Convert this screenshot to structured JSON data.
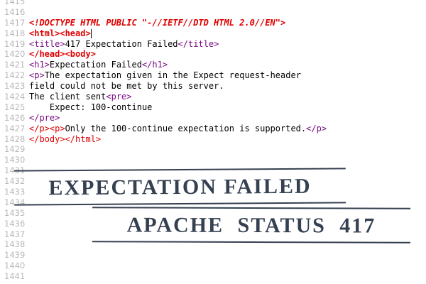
{
  "line_numbers": [
    "1415",
    "1416",
    "1417",
    "1418",
    "1419",
    "1420",
    "1421",
    "1422",
    "1423",
    "1424",
    "1425",
    "1426",
    "1427",
    "1428",
    "1429",
    "1430",
    "1431",
    "1432",
    "1433",
    "1434",
    "1435",
    "1436",
    "1437",
    "1438",
    "1439",
    "1440",
    "1441"
  ],
  "code": {
    "doctype": "<!DOCTYPE HTML PUBLIC \"-//IETF//DTD HTML 2.0//EN\">",
    "html_head": "<html><head>",
    "title_open": "<title>",
    "title_text": "417 Expectation Failed",
    "title_close": "</title>",
    "head_body": "</head><body>",
    "h1_open": "<h1>",
    "h1_text": "Expectation Failed",
    "h1_close": "</h1>",
    "p_open": "<p>",
    "p_text1": "The expectation given in the Expect request-header",
    "p_text2": "field could not be met by this server.",
    "p_text3": "The client sent",
    "pre_open": "<pre>",
    "pre_text": "    Expect: 100-continue",
    "pre_close": "</pre>",
    "p_close_open": "</p><p>",
    "p2_text": "Only the 100-continue expectation is supported.",
    "p2_close": "</p>",
    "body_close": "</body></html>"
  },
  "stamps": {
    "line1": "EXPECTATION  FAILED",
    "line2": "APACHE STATUS 417"
  },
  "colors": {
    "keyword": "#e00000",
    "tag": "#7a0b86",
    "stamp": "#2b3648"
  }
}
